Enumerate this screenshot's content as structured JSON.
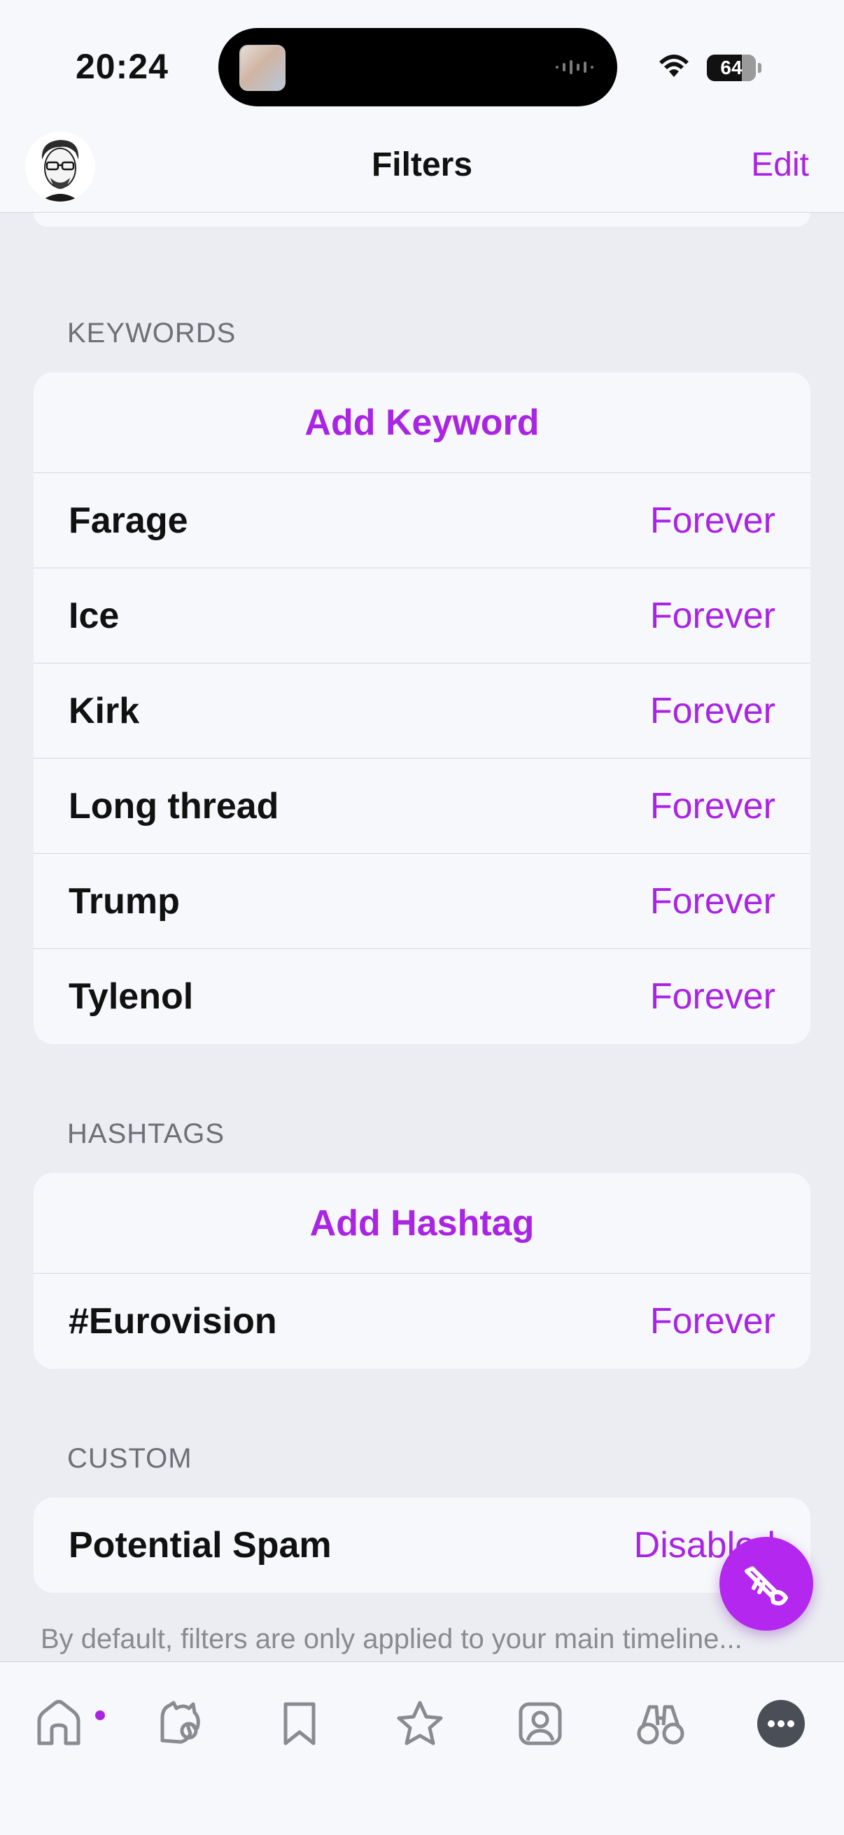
{
  "status_bar": {
    "time": "20:24",
    "battery": "64"
  },
  "nav": {
    "title": "Filters",
    "edit_label": "Edit"
  },
  "sections": {
    "keywords": {
      "label": "KEYWORDS",
      "add_label": "Add Keyword",
      "items": [
        {
          "term": "Farage",
          "duration": "Forever"
        },
        {
          "term": "Ice",
          "duration": "Forever"
        },
        {
          "term": "Kirk",
          "duration": "Forever"
        },
        {
          "term": "Long thread",
          "duration": "Forever"
        },
        {
          "term": "Trump",
          "duration": "Forever"
        },
        {
          "term": "Tylenol",
          "duration": "Forever"
        }
      ]
    },
    "hashtags": {
      "label": "HASHTAGS",
      "add_label": "Add Hashtag",
      "items": [
        {
          "term": "#Eurovision",
          "duration": "Forever"
        }
      ]
    },
    "custom": {
      "label": "CUSTOM",
      "items": [
        {
          "term": "Potential Spam",
          "duration": "Disabled"
        }
      ]
    }
  },
  "footer_note": "By default, filters are only applied to your main timeline...",
  "tabbar": {
    "tabs": [
      "home-icon",
      "mentions-icon",
      "bookmark-icon",
      "favorites-icon",
      "profile-icon",
      "explore-icon",
      "more-icon"
    ]
  },
  "colors": {
    "accent": "#a925e3",
    "background": "#ebedf2",
    "card": "#f7f8fc"
  }
}
